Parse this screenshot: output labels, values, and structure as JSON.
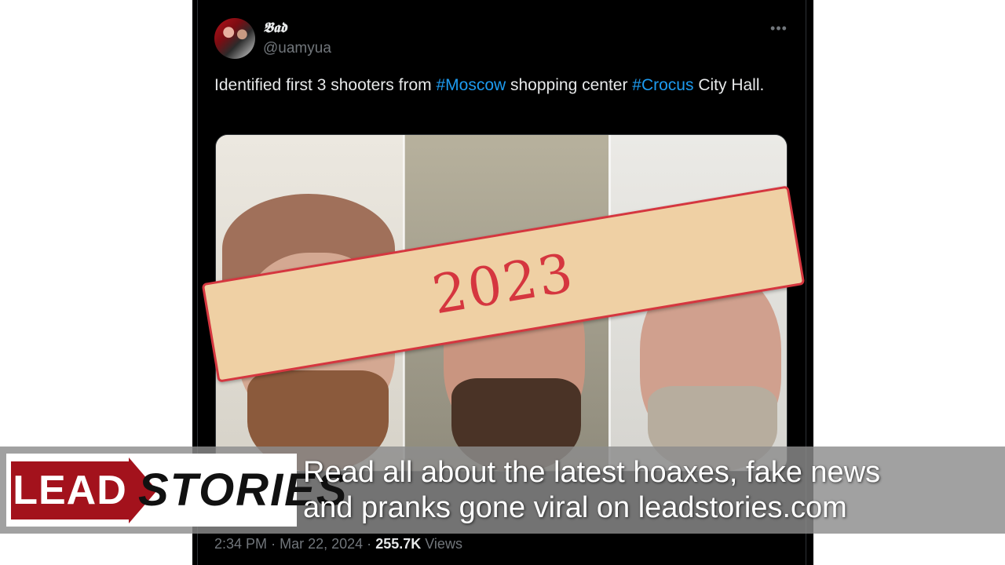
{
  "tweet": {
    "display_name": "𝕭𝖆𝖉",
    "handle": "@uamyua",
    "more_icon": "more-horizontal-icon",
    "text_parts": {
      "p1": "Identified first 3 shooters from ",
      "h1": "#Moscow",
      "p2": " shopping center ",
      "h2": "#Crocus",
      "p3": " City Hall."
    },
    "time": "2:34 PM",
    "date": "Mar 22, 2024",
    "views_count": "255.7K",
    "views_label": "Views",
    "separator": "·"
  },
  "stamp": {
    "text": "2023",
    "color": "#d5363f",
    "background": "#efd0a4"
  },
  "banner": {
    "logo_left": "LEAD",
    "logo_right": "STORIES",
    "line1": "Read all about the latest hoaxes, fake news",
    "line2": "and pranks gone viral on leadstories.com"
  },
  "colors": {
    "hashtag": "#1d9bf0",
    "brand_red": "#a3121c"
  }
}
